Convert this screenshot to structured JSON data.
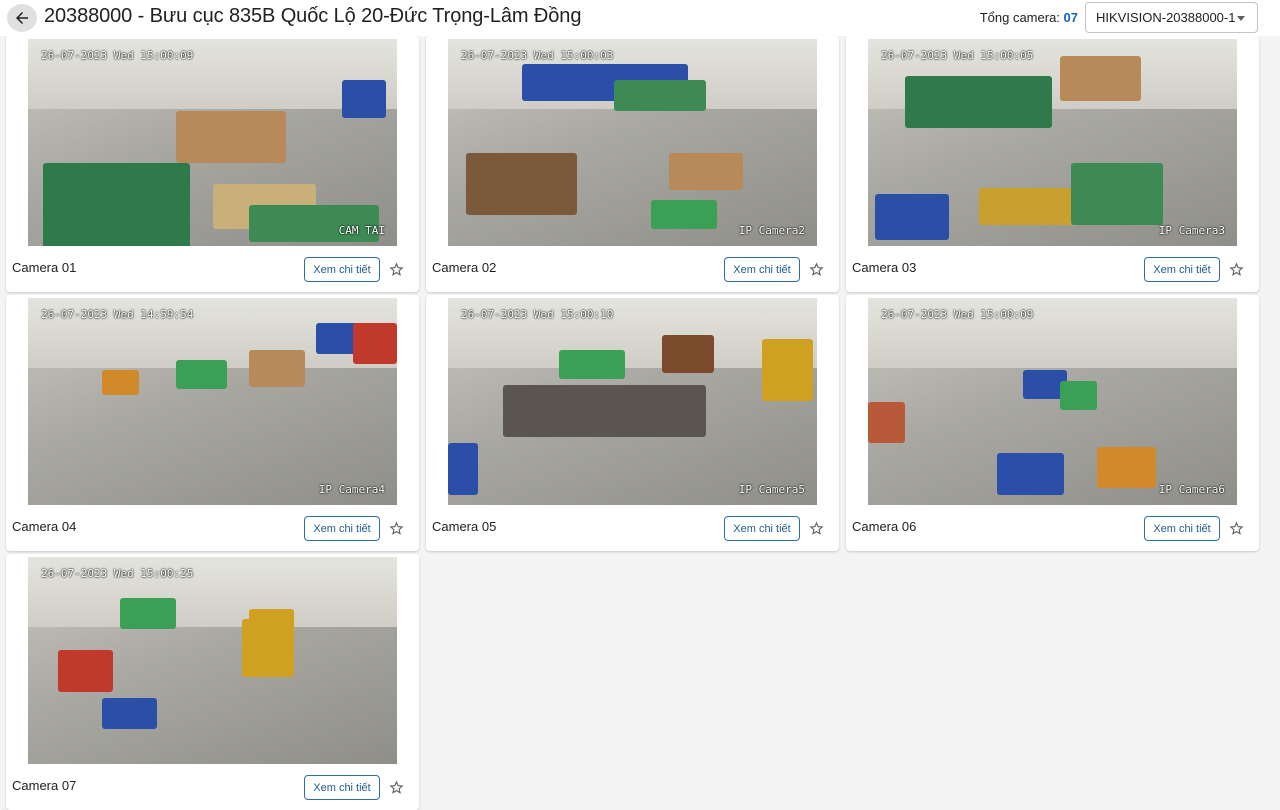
{
  "header": {
    "title": "20388000 - Bưu cục 835B Quốc Lộ 20-Đức Trọng-Lâm Đồng",
    "total_label": "Tổng camera: ",
    "total_count": "07",
    "device_selected": "HIKVISION-20388000-1"
  },
  "cameras": [
    {
      "name": "Camera 01",
      "timestamp": "26-07-2023 Wed 15:00:09",
      "osd_label": "CAM TAI",
      "button": "Xem chi tiết"
    },
    {
      "name": "Camera 02",
      "timestamp": "26-07-2023 Wed 15:00:03",
      "osd_label": "IP Camera2",
      "button": "Xem chi tiết"
    },
    {
      "name": "Camera 03",
      "timestamp": "26-07-2023 Wed 15:00:05",
      "osd_label": "IP Camera3",
      "button": "Xem chi tiết"
    },
    {
      "name": "Camera 04",
      "timestamp": "26-07-2023 Wed 14:59:54",
      "osd_label": "IP Camera4",
      "button": "Xem chi tiết"
    },
    {
      "name": "Camera 05",
      "timestamp": "26-07-2023 Wed 15:00:10",
      "osd_label": "IP Camera5",
      "button": "Xem chi tiết"
    },
    {
      "name": "Camera 06",
      "timestamp": "26-07-2023 Wed 15:00:09",
      "osd_label": "IP Camera6",
      "button": "Xem chi tiết"
    },
    {
      "name": "Camera 07",
      "timestamp": "26-07-2023 Wed 15:00:25",
      "osd_label": "",
      "button": "Xem chi tiết"
    }
  ],
  "icons": {
    "back": "arrow-left-icon",
    "favorite": "star-outline-icon",
    "dropdown": "chevron-down-icon"
  },
  "colors": {
    "accent": "#1565c0",
    "button_border": "#2f6ea3",
    "header_bg": "#ffffff",
    "page_bg": "#f4f4f4"
  }
}
